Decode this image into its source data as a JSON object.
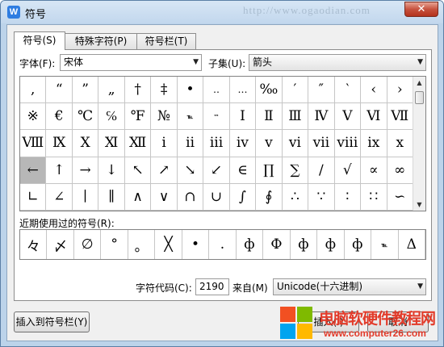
{
  "window": {
    "title": "符号",
    "app_icon": "W",
    "watermark_url": "http://www.ogaodian.com",
    "close": "✕"
  },
  "tabs": [
    {
      "label": "符号(S)",
      "active": true
    },
    {
      "label": "特殊字符(P)",
      "active": false
    },
    {
      "label": "符号栏(T)",
      "active": false
    }
  ],
  "font": {
    "label": "字体(F):",
    "value": "宋体"
  },
  "subset": {
    "label": "子集(U):",
    "value": "箭头"
  },
  "symbols": [
    [
      ",",
      "“",
      "”",
      "„",
      "†",
      "‡",
      "•",
      "‥",
      "…",
      "‰",
      "′",
      "″",
      "‵",
      "‹",
      "›"
    ],
    [
      "※",
      "€",
      "℃",
      "℅",
      "℉",
      "№",
      "℡",
      "™",
      "Ⅰ",
      "Ⅱ",
      "Ⅲ",
      "Ⅳ",
      "Ⅴ",
      "Ⅵ",
      "Ⅶ"
    ],
    [
      "Ⅷ",
      "Ⅸ",
      "Ⅹ",
      "Ⅺ",
      "Ⅻ",
      "ⅰ",
      "ⅱ",
      "ⅲ",
      "ⅳ",
      "ⅴ",
      "ⅵ",
      "ⅶ",
      "ⅷ",
      "ⅸ",
      "ⅹ"
    ],
    [
      "←",
      "↑",
      "→",
      "↓",
      "↖",
      "↗",
      "↘",
      "↙",
      "∈",
      "∏",
      "∑",
      "∕",
      "√",
      "∝",
      "∞"
    ],
    [
      "∟",
      "∠",
      "∣",
      "∥",
      "∧",
      "∨",
      "∩",
      "∪",
      "∫",
      "∮",
      "∴",
      "∵",
      "∶",
      "∷",
      "∽"
    ]
  ],
  "selected_symbol": "←",
  "recent": {
    "label": "近期使用过的符号(R):",
    "symbols": [
      "々",
      "〆",
      "∅",
      "°",
      "。",
      "╳",
      "•",
      ".",
      "ф",
      "Ф",
      "ф",
      "ф",
      "ф",
      "℡",
      "Δ"
    ]
  },
  "char_code": {
    "label": "字符代码(C):",
    "value": "2190"
  },
  "from": {
    "label": "来自(M)",
    "value": "Unicode(十六进制)"
  },
  "buttons": {
    "insert_to_bar": "插入到符号栏(Y)",
    "insert": "插入(I)",
    "cancel": "取消"
  },
  "watermark_logo": {
    "title": "电脑软硬件教程网",
    "url": "www.computer26.com"
  },
  "colors": {
    "selected_cell": "#b7b7b7",
    "title_bar": "#c2d7ed",
    "logo_red": "#e23b2a"
  }
}
